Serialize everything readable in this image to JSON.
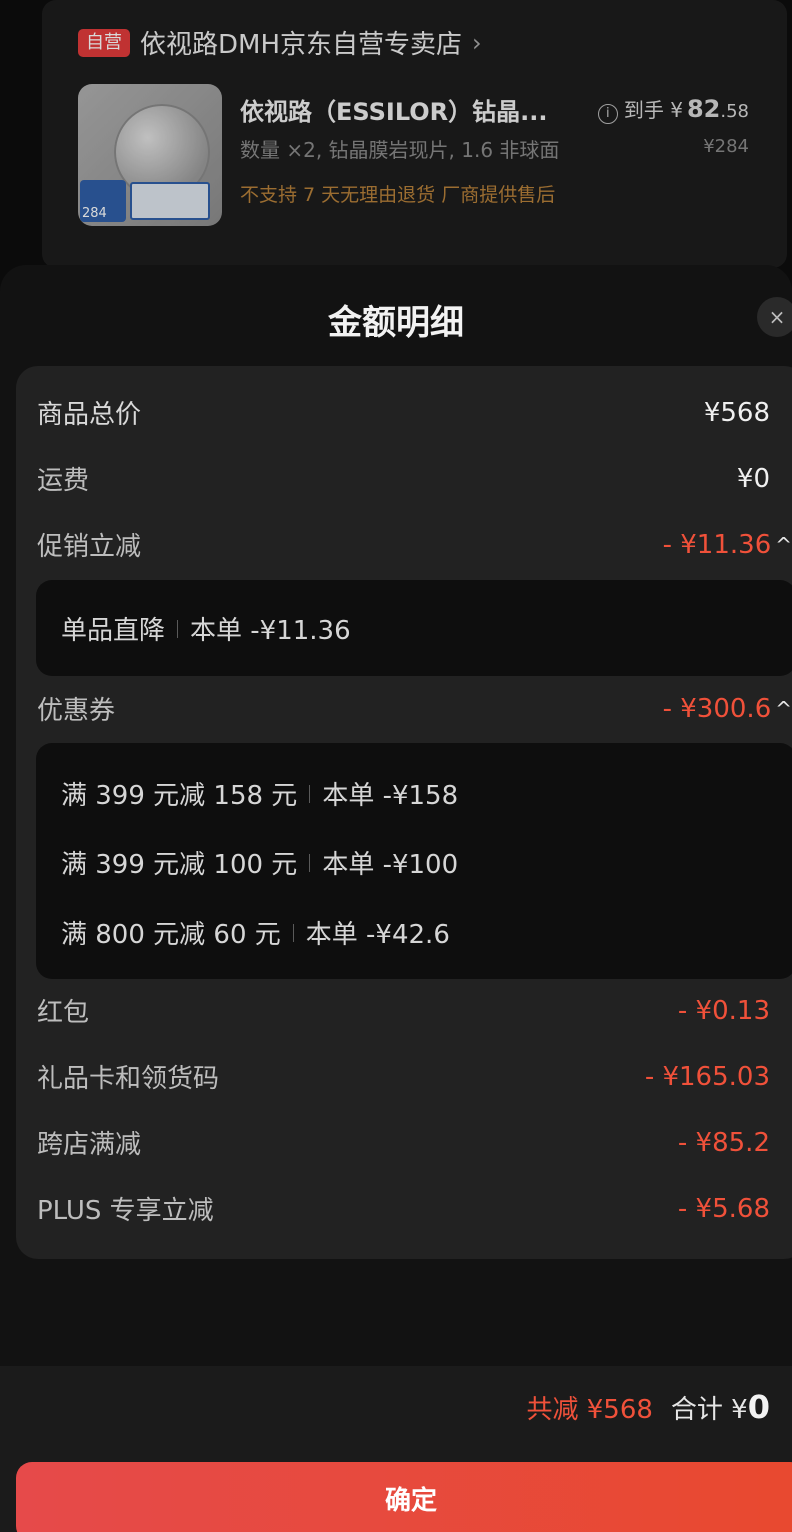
{
  "store": {
    "badge": "自营",
    "name": "依视路DMH京东自营专卖店",
    "chevron": "›"
  },
  "product": {
    "title": "依视路（ESSILOR）钻晶...",
    "spec": "数量 ×2, 钻晶膜岩现片, 1.6 非球面",
    "warning": "不支持 7 天无理由退货   厂商提供售后",
    "price_label": "到手 ¥",
    "price_int": "82",
    "price_dec": ".58",
    "original_price": "¥284",
    "thumb_price": "284",
    "info_icon": "i"
  },
  "sheet": {
    "title": "金额明细",
    "close": "×"
  },
  "rows": {
    "goods_total": {
      "label": "商品总价",
      "value": "¥568"
    },
    "shipping": {
      "label": "运费",
      "value": "¥0"
    },
    "promo": {
      "label": "促销立减",
      "value": "- ¥11.36"
    },
    "coupon": {
      "label": "优惠券",
      "value": "- ¥300.6"
    },
    "red_packet": {
      "label": "红包",
      "value": "- ¥0.13"
    },
    "gift_card": {
      "label": "礼品卡和领货码",
      "value": "- ¥165.03"
    },
    "cross_store": {
      "label": "跨店满减",
      "value": "- ¥85.2"
    },
    "plus": {
      "label": "PLUS 专享立减",
      "value": "- ¥5.68"
    }
  },
  "promo_detail": [
    {
      "name": "单品直降",
      "amount": "本单 -¥11.36"
    }
  ],
  "coupon_detail": [
    {
      "name": "满 399 元减 158 元",
      "amount": "本单 -¥158"
    },
    {
      "name": "满 399 元减 100 元",
      "amount": "本单 -¥100"
    },
    {
      "name": "满 800 元减 60 元",
      "amount": "本单 -¥42.6"
    }
  ],
  "chevron_up": "^",
  "footer": {
    "total_reduce": "共减 ¥568",
    "total_label": "合计 ¥",
    "total_value": "0",
    "confirm": "确定"
  },
  "colors": {
    "accent_red": "#f0513a",
    "badge_red": "#e23b3b",
    "warning_orange": "#b7813a",
    "button_gradient_start": "#e64a4a",
    "button_gradient_end": "#e8492f"
  }
}
